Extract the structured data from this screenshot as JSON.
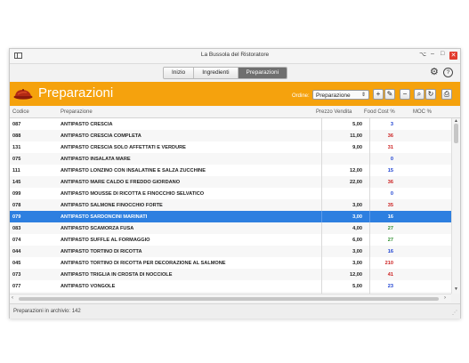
{
  "window": {
    "title": "La Bussola del Ristoratore",
    "controls": [
      "⌥",
      "–",
      "□",
      "✕"
    ]
  },
  "tabs": [
    {
      "label": "Inizio",
      "active": false
    },
    {
      "label": "Ingredienti",
      "active": false
    },
    {
      "label": "Preparazioni",
      "active": true
    }
  ],
  "header": {
    "title": "Preparazioni",
    "order_label": "Ordine:",
    "order_value": "Preparazione",
    "order_arrow": "⇕",
    "accent_color": "#f5a20d",
    "buttons": [
      {
        "name": "add-button",
        "icon": "plus-icon",
        "glyph": "+"
      },
      {
        "name": "edit-button",
        "icon": "edit-icon",
        "glyph": "✎"
      },
      {
        "name": "remove-button",
        "icon": "minus-icon",
        "glyph": "−"
      },
      {
        "name": "search-button",
        "icon": "search-icon",
        "glyph": "⌕"
      },
      {
        "name": "refresh-button",
        "icon": "refresh-icon",
        "glyph": "↻"
      },
      {
        "name": "print-button",
        "icon": "print-icon",
        "glyph": "⎙"
      }
    ]
  },
  "table": {
    "columns": {
      "code": "Codice",
      "prep": "Preparazione",
      "price": "Prezzo Vendita",
      "cost": "Food Cost %",
      "moc": "MOC %"
    },
    "rows": [
      {
        "code": "087",
        "name": "ANTIPASTO CRESCIA",
        "price": "5,00",
        "cost": "3",
        "cost_color": "#1a3fd1"
      },
      {
        "code": "088",
        "name": "ANTIPASTO CRESCIA COMPLETA",
        "price": "11,00",
        "cost": "36",
        "cost_color": "#cc2020"
      },
      {
        "code": "131",
        "name": "ANTIPASTO CRESCIA SOLO AFFETTATI E VERDURE",
        "price": "9,00",
        "cost": "31",
        "cost_color": "#cc2020"
      },
      {
        "code": "075",
        "name": "ANTIPASTO INSALATA MARE",
        "price": "",
        "cost": "0",
        "cost_color": "#1a3fd1"
      },
      {
        "code": "111",
        "name": "ANTIPASTO LONZINO CON INSALATINE E SALZA ZUCCHINE",
        "price": "12,00",
        "cost": "15",
        "cost_color": "#1a3fd1"
      },
      {
        "code": "145",
        "name": "ANTIPASTO MARE CALDO E FREDDO GIORDANO",
        "price": "22,00",
        "cost": "36",
        "cost_color": "#cc2020"
      },
      {
        "code": "099",
        "name": "ANTIPASTO MOUSSE DI RICOTTA E FINOCCHIO SELVATICO",
        "price": "",
        "cost": "0",
        "cost_color": "#1a3fd1"
      },
      {
        "code": "078",
        "name": "ANTIPASTO SALMONE FINOCCHIO FORTE",
        "price": "3,00",
        "cost": "35",
        "cost_color": "#cc2020"
      },
      {
        "code": "079",
        "name": "ANTIPASTO SARDONCINI MARINATI",
        "price": "3,00",
        "cost": "16",
        "cost_color": "#ffffff",
        "selected": true
      },
      {
        "code": "083",
        "name": "ANTIPASTO SCAMORZA FUSA",
        "price": "4,00",
        "cost": "27",
        "cost_color": "#2f8f2f"
      },
      {
        "code": "074",
        "name": "ANTIPASTO SUFFLE AL FORMAGGIO",
        "price": "6,00",
        "cost": "27",
        "cost_color": "#2f8f2f"
      },
      {
        "code": "044",
        "name": "ANTIPASTO TORTINO DI RICOTTA",
        "price": "3,00",
        "cost": "16",
        "cost_color": "#1a3fd1"
      },
      {
        "code": "045",
        "name": "ANTIPASTO TORTINO DI RICOTTA PER DECORAZIONE AL SALMONE",
        "price": "3,00",
        "cost": "210",
        "cost_color": "#cc2020"
      },
      {
        "code": "073",
        "name": "ANTIPASTO TRIGLIA IN CROSTA DI NOCCIOLE",
        "price": "12,00",
        "cost": "41",
        "cost_color": "#cc2020"
      },
      {
        "code": "077",
        "name": "ANTIPASTO VONGOLE",
        "price": "5,00",
        "cost": "23",
        "cost_color": "#1a3fd1"
      },
      {
        "code": "",
        "name": "",
        "price": "",
        "cost": "",
        "cost_color": "#1a3fd1"
      }
    ]
  },
  "status": {
    "text": "Preparazioni in archivio: 142"
  }
}
